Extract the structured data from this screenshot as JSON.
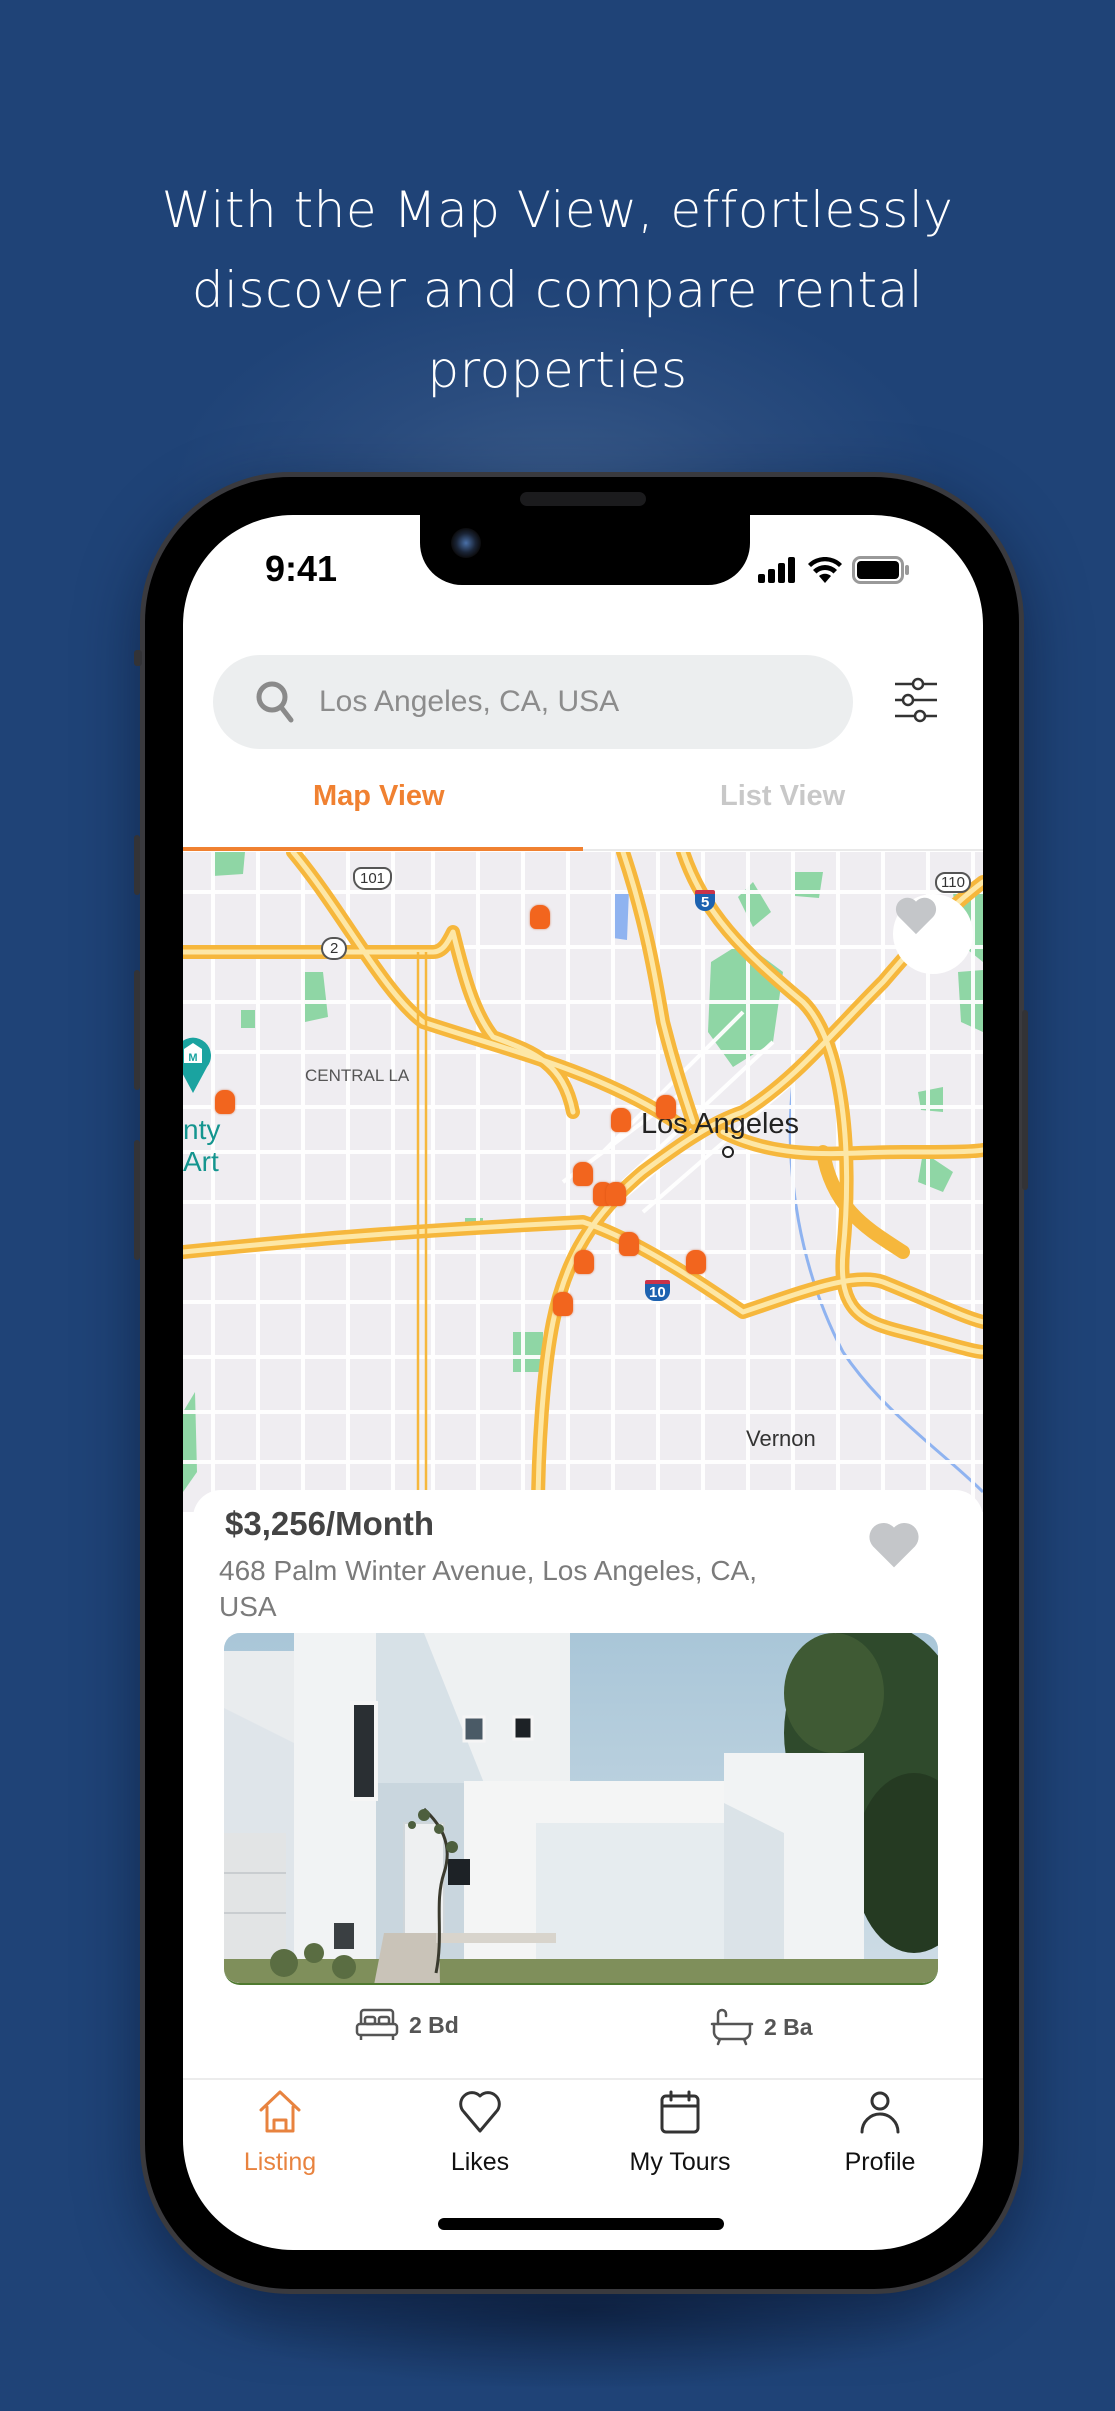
{
  "headline": {
    "lines": [
      "With the Map View, effortlessly",
      "discover and compare rental",
      "properties"
    ]
  },
  "status_bar": {
    "time": "9:41",
    "icons": [
      "signal-icon",
      "wifi-icon",
      "battery-icon"
    ]
  },
  "search": {
    "value": "Los Angeles, CA, USA",
    "icon": "search-icon",
    "filter_icon": "sliders-icon"
  },
  "tabs": [
    {
      "label": "Map View",
      "active": true
    },
    {
      "label": "List View",
      "active": false
    }
  ],
  "map": {
    "labels": {
      "central_la": "CENTRAL LA",
      "los_angeles": "Los Angeles",
      "vernon": "Vernon",
      "museum_partial_1": "nty",
      "museum_partial_2": "Art",
      "route_101": "101",
      "route_2": "2",
      "route_5": "5",
      "route_10": "10",
      "route_110": "110"
    },
    "property_pin_count": 12,
    "favorite_button_icon": "heart-icon"
  },
  "listing": {
    "price": "$3,256/Month",
    "address": "468 Palm Winter Avenue, Los Angeles, CA, USA",
    "photo": "modern-white-house-photo",
    "bedrooms": "2 Bd",
    "bathrooms": "2 Ba"
  },
  "bottom_nav": [
    {
      "label": "Listing",
      "icon": "home-icon",
      "active": true
    },
    {
      "label": "Likes",
      "icon": "heart-outline-icon",
      "active": false
    },
    {
      "label": "My Tours",
      "icon": "calendar-icon",
      "active": false
    },
    {
      "label": "Profile",
      "icon": "person-icon",
      "active": false
    }
  ],
  "colors": {
    "background": "#1f4377",
    "accent": "#f08131",
    "pin": "#f2651e",
    "highway": "#f9c23c",
    "park": "#8fd6a5"
  }
}
